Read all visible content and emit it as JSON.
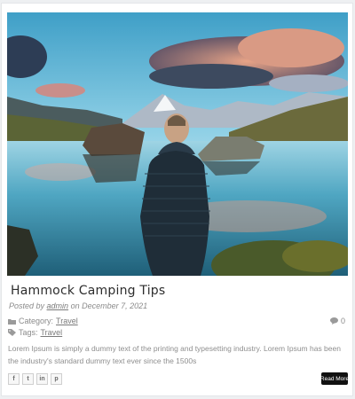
{
  "post": {
    "title": "Hammock Camping Tips",
    "posted_prefix": "Posted by",
    "author": "admin",
    "date_prefix": "on",
    "date": "December 7, 2021",
    "category_label": "Category:",
    "category": "Travel",
    "tags_label": "Tags:",
    "tag": "Travel",
    "comments_count": "0",
    "excerpt": "Lorem Ipsum is simply a dummy text of the printing and typesetting industry. Lorem Ipsum has been the industry's standard dummy text ever since the 1500s",
    "read_more": "Read More"
  },
  "share_icons": [
    {
      "name": "facebook-icon",
      "glyph": "f"
    },
    {
      "name": "twitter-icon",
      "glyph": "t"
    },
    {
      "name": "linkedin-icon",
      "glyph": "in"
    },
    {
      "name": "pinterest-icon",
      "glyph": "p"
    }
  ],
  "colors": {
    "accent_button": "#111111",
    "meta_text": "#8b8b8b"
  }
}
